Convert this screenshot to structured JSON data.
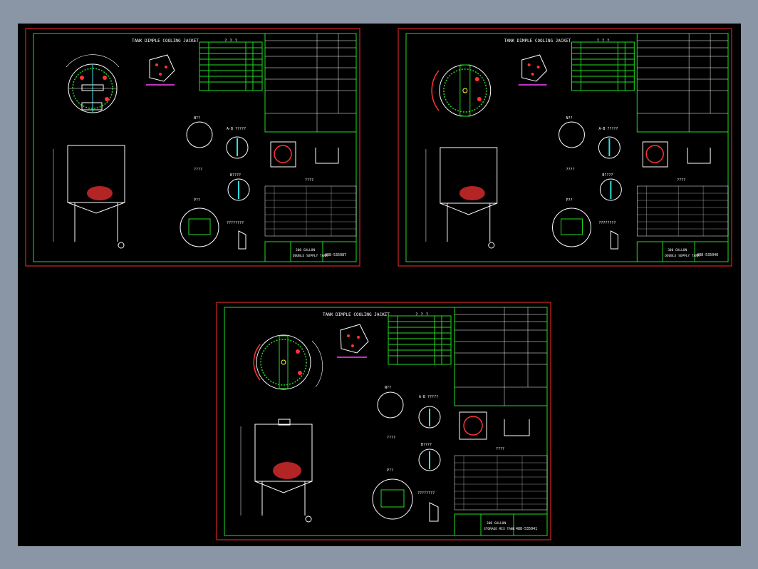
{
  "viewer": {
    "background_color": "#8a96a6",
    "canvas_color": "#000000"
  },
  "colors": {
    "border_outer": "#ff2a2a",
    "border_inner": "#22dd22",
    "table_frame": "#22dd22",
    "line": "#ffffff",
    "accent_red": "#ff3333",
    "accent_cyan": "#33dddd",
    "accent_magenta": "#ff44ff",
    "accent_yellow": "#ffff44"
  },
  "sheets": [
    {
      "title": "TANK DIMPLE COOLING JACKET",
      "label_question": "? ? ?",
      "detail_label_1": "N??",
      "detail_label_2": "A-B ?????",
      "detail_label_3": "????",
      "detail_label_4": "B????",
      "detail_label_5": "P??",
      "detail_label_6": "????????",
      "table_label": "????",
      "title_block_name": "300 GALLON",
      "title_block_desc": "DOUBLE SUPPLY TANK",
      "drawing_number": "488-535087"
    },
    {
      "title": "TANK DIMPLE COOLING JACKET",
      "label_question": "? ? ?",
      "detail_label_1": "N??",
      "detail_label_2": "A-B ?????",
      "detail_label_3": "????",
      "detail_label_4": "B????",
      "detail_label_5": "P??",
      "detail_label_6": "????????",
      "table_label": "????",
      "title_block_name": "300 GALLON",
      "title_block_desc": "DOUBLE SUPPLY TANK",
      "drawing_number": "488-535040"
    },
    {
      "title": "TANK DIMPLE COOLING JACKET",
      "label_question": "? ? ?",
      "detail_label_1": "N??",
      "detail_label_2": "A-B ?????",
      "detail_label_3": "????",
      "detail_label_4": "B????",
      "detail_label_5": "P??",
      "detail_label_6": "????????",
      "table_label": "????",
      "title_block_name": "300 GALLON",
      "title_block_desc": "STORAGE MIX TANK",
      "drawing_number": "488-535041"
    }
  ]
}
